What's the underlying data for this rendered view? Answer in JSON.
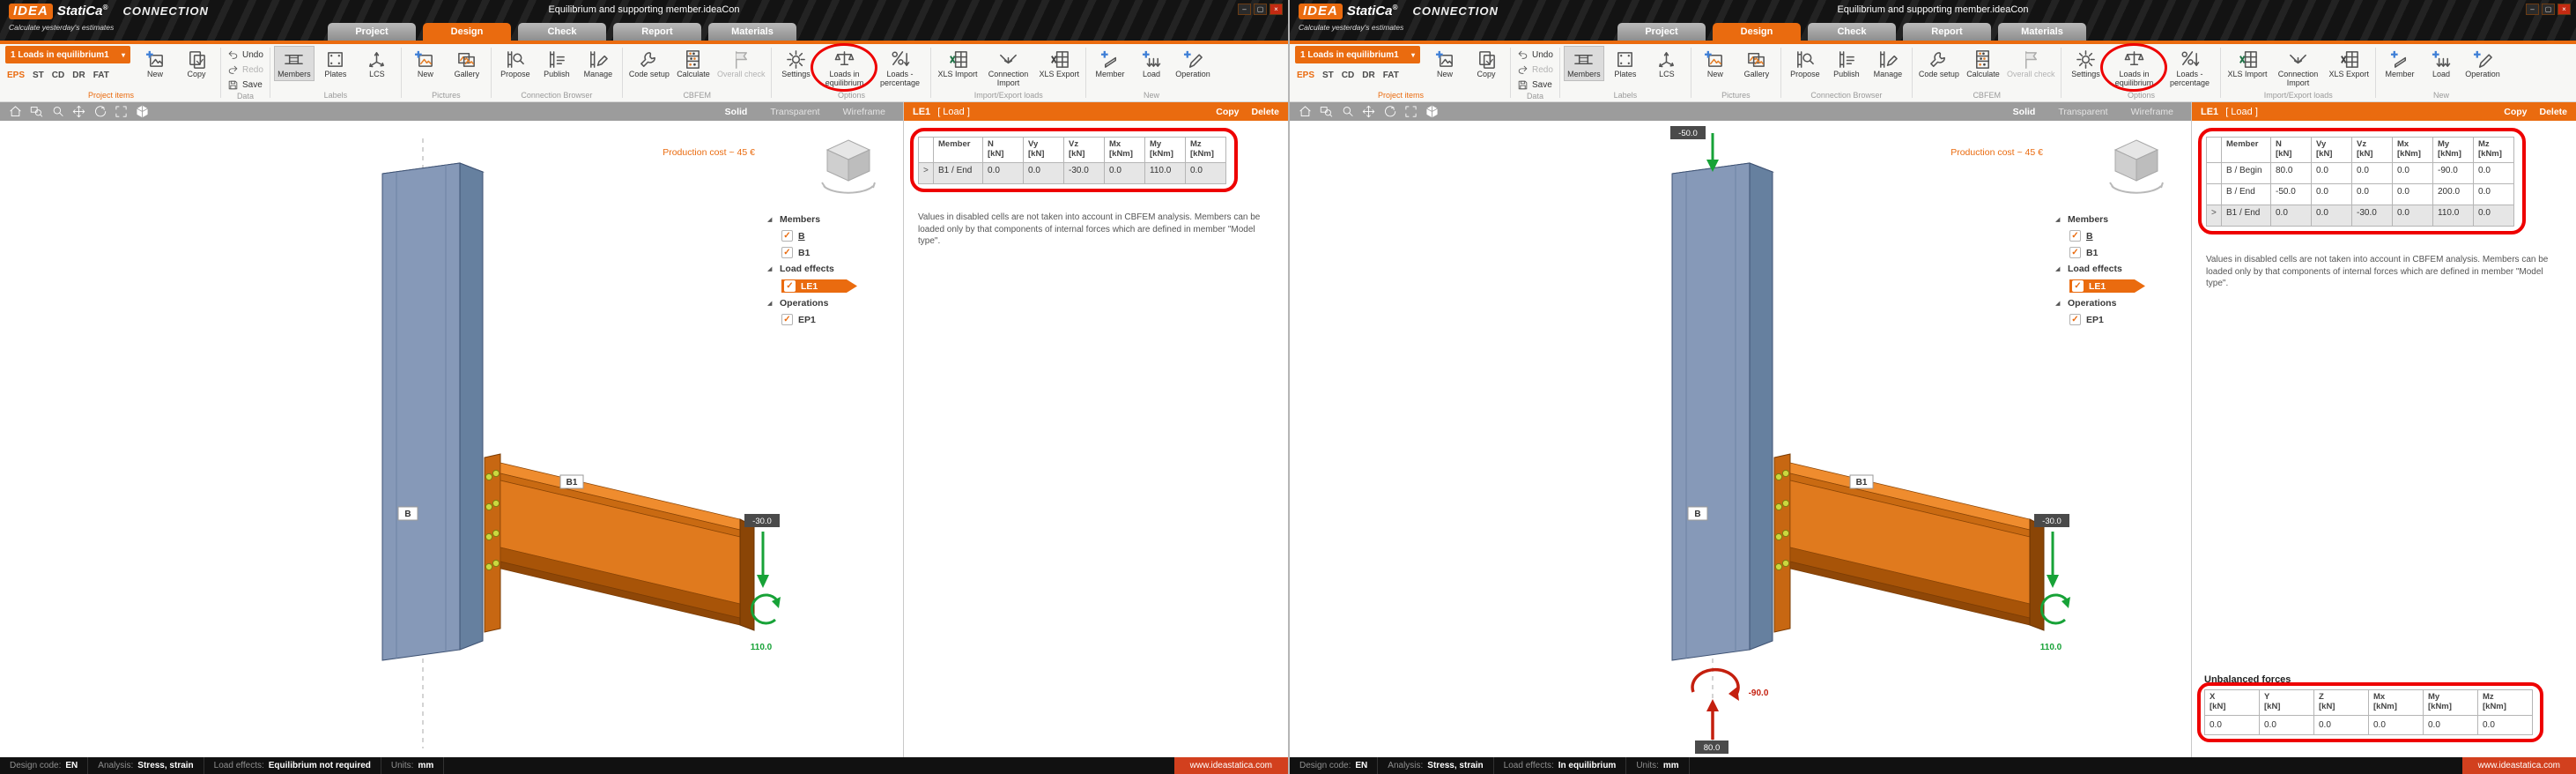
{
  "app": {
    "logo": {
      "idea": "IDEA",
      "statica": "StatiCa",
      "reg": "®",
      "product": "CONNECTION",
      "tagline": "Calculate yesterday's estimates"
    },
    "title": "Equilibrium and supporting member.ideaCon",
    "window_buttons": {
      "minimize": "–",
      "maximize": "▢",
      "close": "×"
    },
    "tabs": {
      "project": "Project",
      "design": "Design",
      "check": "Check",
      "report": "Report",
      "materials": "Materials"
    }
  },
  "ribbon": {
    "project_items": {
      "dropdown": "1 Loads in equilibrium1",
      "caret": "▾",
      "modes": [
        "EPS",
        "ST",
        "CD",
        "DR",
        "FAT"
      ],
      "new": "New",
      "copy": "Copy",
      "group": "Project items"
    },
    "data": {
      "undo": "Undo",
      "redo": "Redo",
      "save": "Save",
      "group": "Data"
    },
    "labels": {
      "members": "Members",
      "plates": "Plates",
      "lcs": "LCS",
      "group": "Labels"
    },
    "pictures": {
      "new": "New",
      "gallery": "Gallery",
      "group": "Pictures"
    },
    "connection_browser": {
      "propose": "Propose",
      "publish": "Publish",
      "manage": "Manage",
      "group": "Connection Browser"
    },
    "cbfem": {
      "code_setup": "Code setup",
      "calculate": "Calculate",
      "overall_check": "Overall check",
      "group": "CBFEM"
    },
    "options": {
      "settings": "Settings",
      "loads_in_equilibrium": "Loads in equilibrium",
      "loads_percentage": "Loads - percentage",
      "group": "Options"
    },
    "import_export": {
      "xls_import": "XLS Import",
      "connection_import": "Connection Import",
      "xls_export": "XLS Export",
      "group": "Import/Export loads"
    },
    "new": {
      "member": "Member",
      "load": "Load",
      "operation": "Operation",
      "group": "New"
    }
  },
  "viewport": {
    "modes": {
      "solid": "Solid",
      "transparent": "Transparent",
      "wireframe": "Wireframe"
    },
    "production_cost": "Production cost ~ 45 €",
    "tree": {
      "expander": "◢",
      "check": "✓",
      "members": "Members",
      "member_b": "B",
      "member_b1": "B1",
      "load_effects": "Load effects",
      "le1": "LE1",
      "operations": "Operations",
      "ep1": "EP1"
    },
    "member_labels": {
      "column": "B",
      "beam": "B1"
    }
  },
  "panel": {
    "title": "LE1",
    "subtitle": "[ Load ]",
    "copy": "Copy",
    "delete": "Delete",
    "row_marker": ">",
    "columns": [
      {
        "name": "Member",
        "unit": ""
      },
      {
        "name": "N",
        "unit": "[kN]"
      },
      {
        "name": "Vy",
        "unit": "[kN]"
      },
      {
        "name": "Vz",
        "unit": "[kN]"
      },
      {
        "name": "Mx",
        "unit": "[kNm]"
      },
      {
        "name": "My",
        "unit": "[kNm]"
      },
      {
        "name": "Mz",
        "unit": "[kNm]"
      }
    ],
    "note": "Values in disabled cells are not taken into account in CBFEM analysis. Members can be loaded only by that components of internal forces which are defined in member \"Model type\".",
    "unbalanced": {
      "title": "Unbalanced forces",
      "columns": [
        {
          "name": "X",
          "unit": "[kN]"
        },
        {
          "name": "Y",
          "unit": "[kN]"
        },
        {
          "name": "Z",
          "unit": "[kN]"
        },
        {
          "name": "Mx",
          "unit": "[kNm]"
        },
        {
          "name": "My",
          "unit": "[kNm]"
        },
        {
          "name": "Mz",
          "unit": "[kNm]"
        }
      ]
    }
  },
  "status": {
    "design_code_label": "Design code:",
    "design_code": "EN",
    "analysis_label": "Analysis:",
    "analysis": "Stress, strain",
    "load_effects_label": "Load effects:",
    "units_label": "Units:",
    "units": "mm",
    "website": "www.ideastatica.com"
  },
  "instances": [
    {
      "load_effects_status": "Equilibrium not required",
      "rows": [
        {
          "member": "B1 / End",
          "n": "0.0",
          "vy": "0.0",
          "vz": "-30.0",
          "mx": "0.0",
          "my": "110.0",
          "mz": "0.0",
          "selected": true
        }
      ],
      "scene": {
        "beam_force": "-30.0",
        "beam_moment": "110.0"
      }
    },
    {
      "load_effects_status": "In equilibrium",
      "rows": [
        {
          "member": "B / Begin",
          "n": "80.0",
          "vy": "0.0",
          "vz": "0.0",
          "mx": "0.0",
          "my": "-90.0",
          "mz": "0.0"
        },
        {
          "member": "B / End",
          "n": "-50.0",
          "vy": "0.0",
          "vz": "0.0",
          "mx": "0.0",
          "my": "200.0",
          "mz": "0.0"
        },
        {
          "member": "B1 / End",
          "n": "0.0",
          "vy": "0.0",
          "vz": "-30.0",
          "mx": "0.0",
          "my": "110.0",
          "mz": "0.0",
          "selected": true
        }
      ],
      "scene": {
        "top_force": "-50.0",
        "beam_force": "-30.0",
        "beam_moment": "110.0",
        "base_moment": "-90.0",
        "base_force": "80.0"
      },
      "unbalanced_values": [
        "0.0",
        "0.0",
        "0.0",
        "0.0",
        "0.0",
        "0.0"
      ]
    }
  ]
}
